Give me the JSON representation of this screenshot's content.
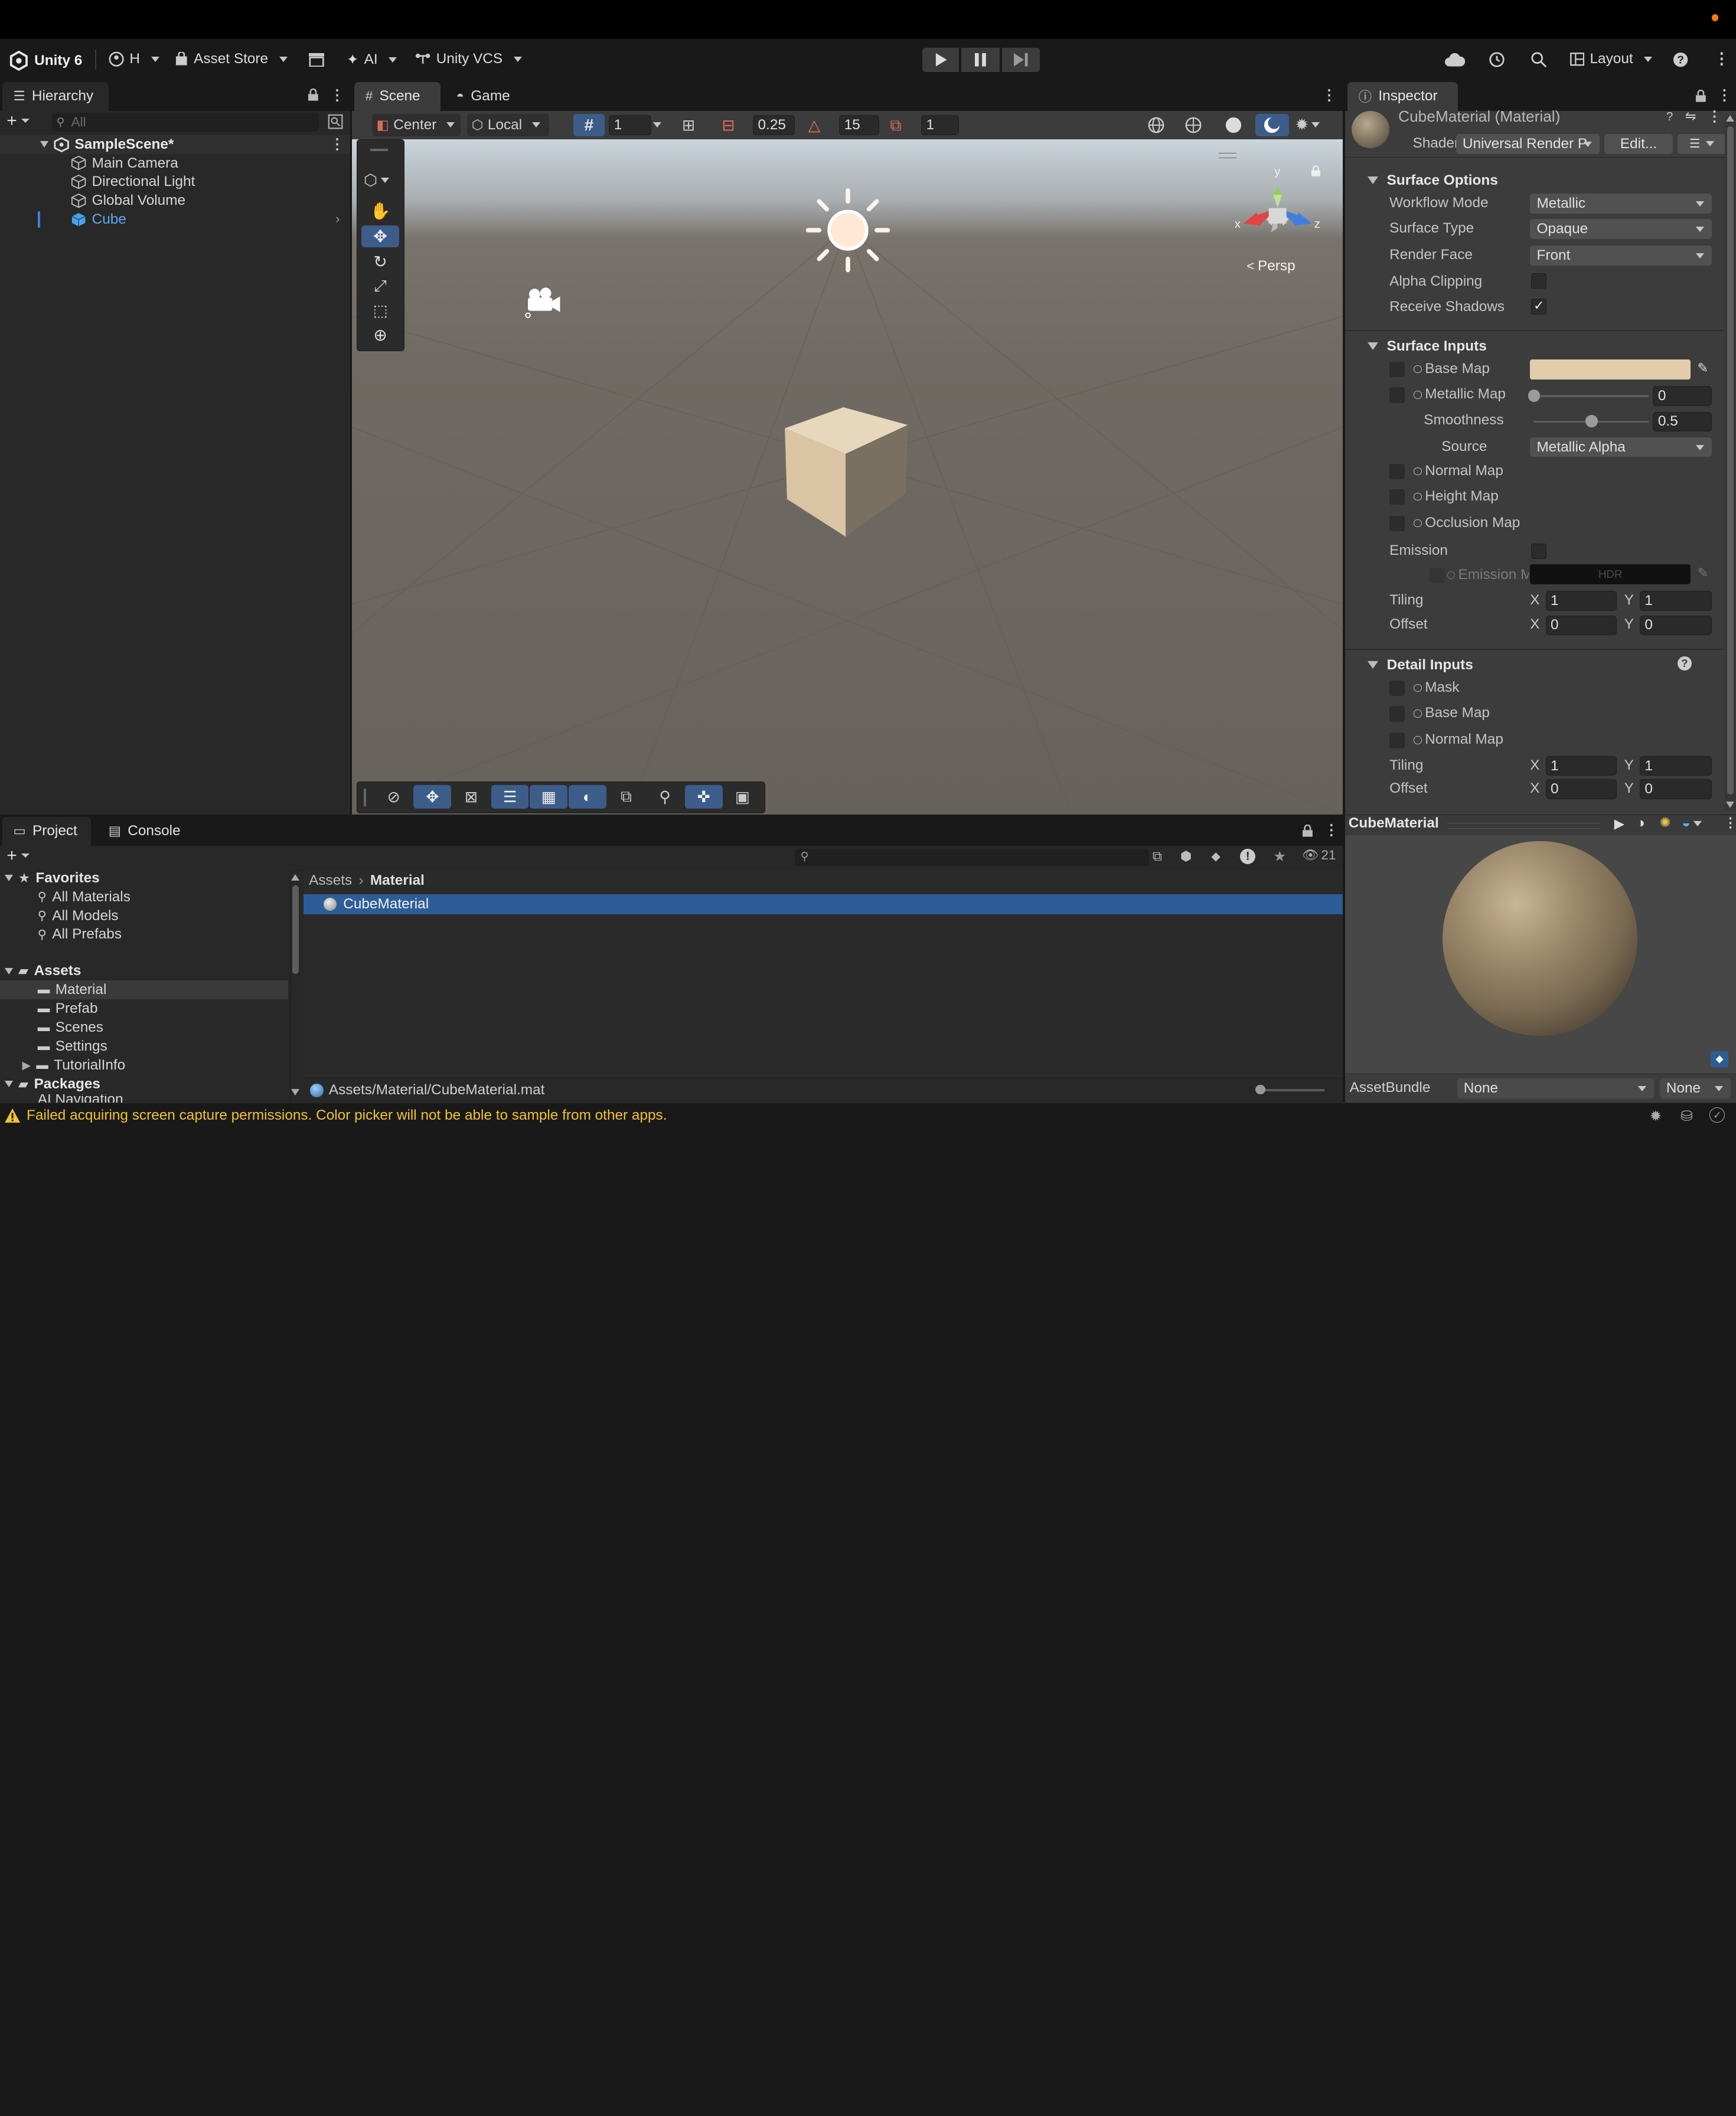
{
  "toolbar": {
    "app_name": "Unity 6",
    "account": "H",
    "asset_store": "Asset Store",
    "ai": "AI",
    "vcs": "Unity VCS",
    "layout": "Layout"
  },
  "hierarchy": {
    "tab": "Hierarchy",
    "search_placeholder": "All",
    "scene": "SampleScene*",
    "items": [
      "Main Camera",
      "Directional Light",
      "Global Volume",
      "Cube"
    ]
  },
  "scene_view": {
    "tabs": [
      "Scene",
      "Game"
    ],
    "pivot": "Center",
    "space": "Local",
    "grid_size": "1",
    "snap_increment": "0.25",
    "rotate_snap": "15",
    "scale_snap": "1",
    "persp_label": "Persp",
    "gizmo_axes": {
      "y": "y",
      "x": "x",
      "z": "z"
    }
  },
  "inspector": {
    "tab": "Inspector",
    "material_title": "CubeMaterial (Material)",
    "shader_label": "Shader",
    "shader_value": "Universal Render P",
    "edit_button": "Edit...",
    "surface_options": {
      "header": "Surface Options",
      "workflow_mode_label": "Workflow Mode",
      "workflow_mode": "Metallic",
      "surface_type_label": "Surface Type",
      "surface_type": "Opaque",
      "render_face_label": "Render Face",
      "render_face": "Front",
      "alpha_clipping_label": "Alpha Clipping",
      "alpha_clipping": false,
      "receive_shadows_label": "Receive Shadows",
      "receive_shadows": true
    },
    "surface_inputs": {
      "header": "Surface Inputs",
      "base_map_label": "Base Map",
      "base_color": "#e3ccab",
      "metallic_map_label": "Metallic Map",
      "metallic_value": "0",
      "metallic_fraction": 0.0,
      "smoothness_label": "Smoothness",
      "smoothness_value": "0.5",
      "smoothness_fraction": 0.5,
      "source_label": "Source",
      "source_value": "Metallic Alpha",
      "normal_map_label": "Normal Map",
      "height_map_label": "Height Map",
      "occlusion_map_label": "Occlusion Map",
      "emission_label": "Emission",
      "emission_map_label": "Emission M",
      "emission_hdr": "HDR",
      "tiling_label": "Tiling",
      "tiling_x": "1",
      "tiling_y": "1",
      "offset_label": "Offset",
      "offset_x": "0",
      "offset_y": "0",
      "x_label": "X",
      "y_label": "Y"
    },
    "detail_inputs": {
      "header": "Detail Inputs",
      "mask_label": "Mask",
      "base_map_label": "Base Map",
      "normal_map_label": "Normal Map",
      "tiling_label": "Tiling",
      "tiling_x": "1",
      "tiling_y": "1",
      "offset_label": "Offset",
      "offset_x": "0",
      "offset_y": "0"
    },
    "preview": {
      "title": "CubeMaterial",
      "assetbundle_label": "AssetBundle",
      "assetbundle_value": "None",
      "variant_value": "None"
    }
  },
  "project": {
    "tabs": [
      "Project",
      "Console"
    ],
    "hidden_count": "21",
    "favorites_header": "Favorites",
    "favorites": [
      "All Materials",
      "All Models",
      "All Prefabs"
    ],
    "assets_header": "Assets",
    "folders": [
      "Material",
      "Prefab",
      "Scenes",
      "Settings",
      "TutorialInfo"
    ],
    "packages_header": "Packages",
    "packages_partial": "AI Navigation",
    "breadcrumb": [
      "Assets",
      "Material"
    ],
    "selected_file": "CubeMaterial",
    "path": "Assets/Material/CubeMaterial.mat"
  },
  "status": {
    "message": "Failed acquiring screen capture permissions. Color picker will not be able to sample from other apps."
  },
  "colors": {
    "accent": "#3c5d8a",
    "selection": "#2c5d96",
    "warning": "#f2c230",
    "cube": "#d9c4a4"
  }
}
